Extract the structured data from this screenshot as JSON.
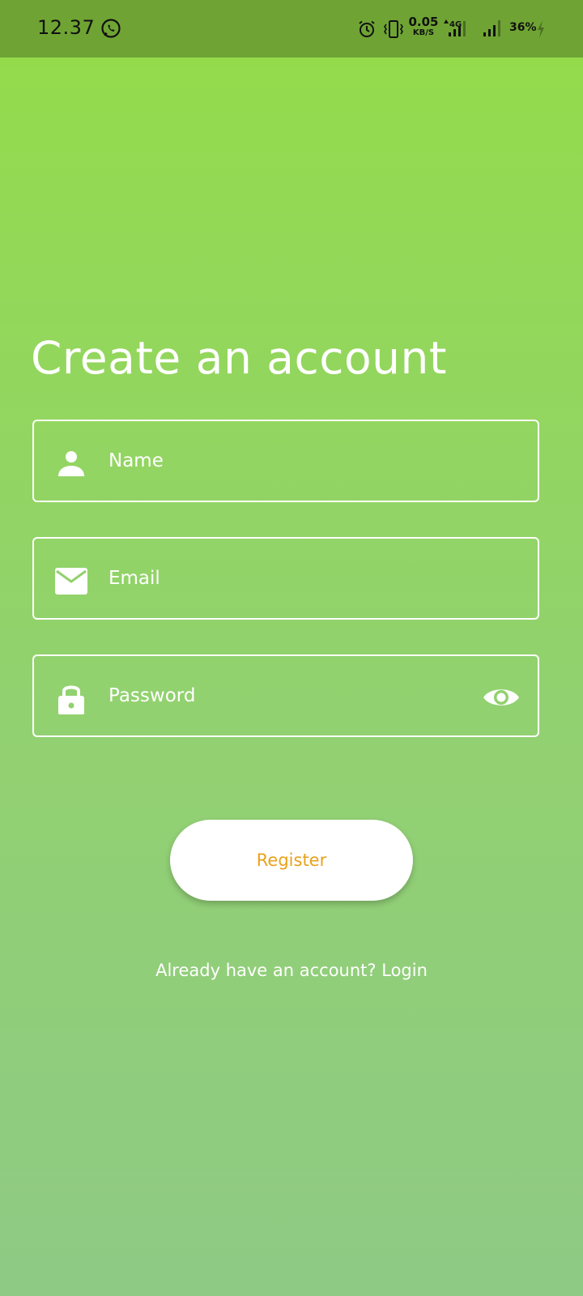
{
  "status_bar": {
    "time": "12.37",
    "net_speed_value": "0.05",
    "net_speed_unit": "KB/S",
    "network_type": "4G",
    "battery": "36%"
  },
  "screen": {
    "title": "Create an account"
  },
  "form": {
    "name_placeholder": "Name",
    "email_placeholder": "Email",
    "password_placeholder": "Password"
  },
  "actions": {
    "register_label": "Register",
    "login_prompt": "Already have an account?",
    "login_link": "Login"
  },
  "colors": {
    "background_top": "#94dc49",
    "background_bottom": "#8fca85",
    "status_bar": "#6fa434",
    "accent": "#e8a21b"
  },
  "icons": [
    "whatsapp-icon",
    "alarm-icon",
    "vibrate-icon",
    "signal-icon",
    "charging-icon",
    "person-icon",
    "mail-icon",
    "lock-icon",
    "eye-icon"
  ]
}
